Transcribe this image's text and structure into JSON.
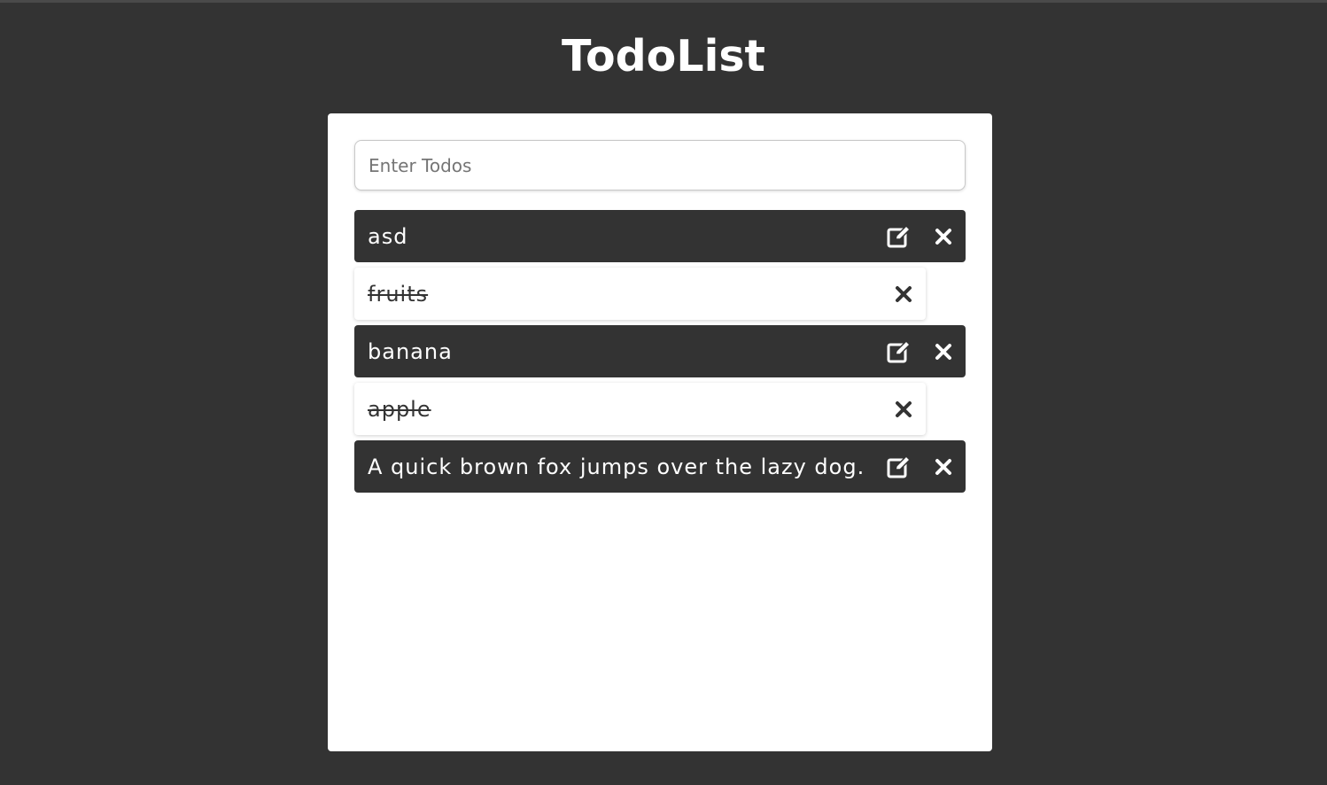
{
  "app": {
    "title": "TodoList"
  },
  "input": {
    "placeholder": "Enter Todos",
    "value": ""
  },
  "todos": [
    {
      "text": "asd",
      "completed": false
    },
    {
      "text": "fruits",
      "completed": true
    },
    {
      "text": "banana",
      "completed": false
    },
    {
      "text": "apple",
      "completed": true
    },
    {
      "text": "A quick brown fox jumps over the lazy dog.",
      "completed": false
    }
  ],
  "icons": {
    "edit": "edit-icon",
    "delete": "close-icon"
  },
  "colors": {
    "background": "#333333",
    "card": "#ffffff",
    "active_item_bg": "#333333",
    "active_item_text": "#ffffff",
    "done_item_bg": "#ffffff",
    "done_item_text": "#333333"
  }
}
